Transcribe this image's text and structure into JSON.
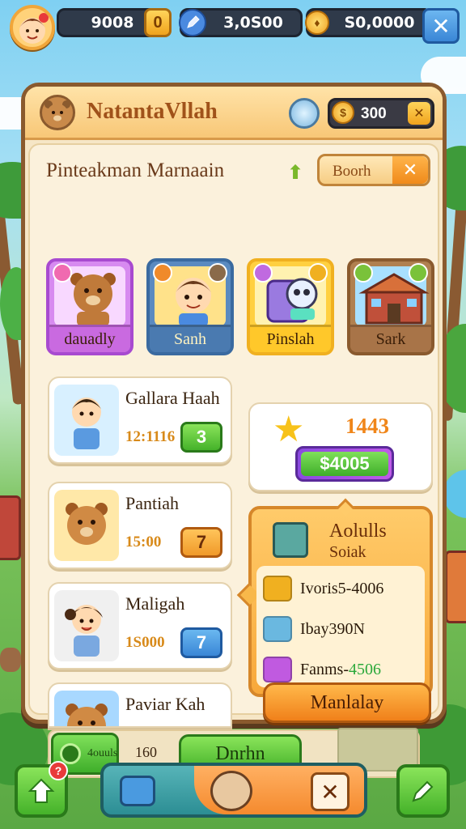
{
  "hud": {
    "currency_1": "9008",
    "currency_1_plus": "0",
    "currency_2": "3,0S00",
    "currency_3": "S0,0000",
    "close_label": "✕"
  },
  "panel": {
    "title": "NatantaVllah",
    "currency_value": "300",
    "subtitle": "Pinteakman Marnaain",
    "search_label": "Boorh",
    "categories": [
      {
        "label": "dauadly",
        "border": "#a84ad0",
        "bg": "#f8d8ff",
        "badge": "#f06ab0"
      },
      {
        "label": "Sanh",
        "border": "#3a6aa0",
        "bg": "#ffe28a",
        "badge": "#f08a2a"
      },
      {
        "label": "Pinslah",
        "border": "#f0b020",
        "bg": "#fff2b0",
        "badge": "#f0b020"
      },
      {
        "label": "Sark",
        "border": "#8a5a2e",
        "bg": "#a8e0ff",
        "badge": "#7ac23a"
      }
    ],
    "items": [
      {
        "name": "Gallara Haah",
        "number": "12:1116",
        "button": "3",
        "btn_color": "green"
      },
      {
        "name": "Pantiah",
        "number": "15:00",
        "button": "7",
        "btn_color": "orange"
      },
      {
        "name": "Maligah",
        "number": "1S000",
        "button": "7",
        "btn_color": "blue"
      },
      {
        "name": "Paviar Kah",
        "number": "",
        "button": "",
        "btn_color": "none"
      }
    ],
    "reward": {
      "value": "1443",
      "price": "$4005"
    },
    "offer": {
      "title": "Aolulls",
      "subtitle": "Soiak",
      "rows": [
        {
          "text_a": "Ivoris5-4006",
          "text_b": ""
        },
        {
          "text_a": "Ibay390N",
          "text_b": ""
        },
        {
          "text_a": "Fanms-",
          "text_b": "4506"
        }
      ]
    },
    "action_button": "Manlalay",
    "bottom": {
      "small_label": "4ouuls",
      "count": "160",
      "green_button": "Dnrhn"
    }
  },
  "nav": {
    "notification_count": "?"
  },
  "colors": {
    "panel_border": "#8a5a2e",
    "accent_orange": "#f0801a",
    "accent_green": "#3fae2a",
    "hud_dark": "#2f3a4a"
  }
}
